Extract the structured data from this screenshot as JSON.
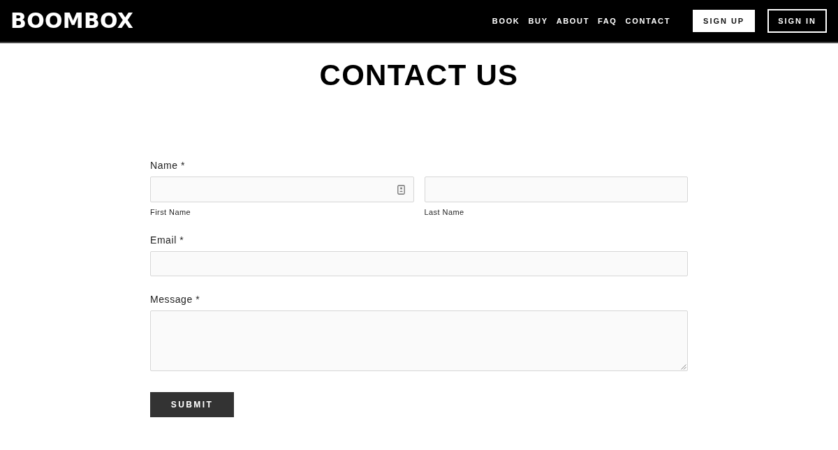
{
  "header": {
    "logo": "BOOMBOX",
    "nav": [
      {
        "label": "BOOK"
      },
      {
        "label": "BUY"
      },
      {
        "label": "ABOUT"
      },
      {
        "label": "FAQ"
      },
      {
        "label": "CONTACT"
      }
    ],
    "buttons": [
      {
        "label": "SIGN UP",
        "kind": "filled"
      },
      {
        "label": "SIGN IN",
        "kind": "outline"
      }
    ]
  },
  "title": "CONTACT US",
  "form": {
    "fields": [
      {
        "kind": "split",
        "label": "Name *",
        "inputs": [
          {
            "sublabel": "First Name",
            "autofill_icon": true
          },
          {
            "sublabel": "Last Name",
            "autofill_icon": false
          }
        ]
      },
      {
        "kind": "line",
        "label": "Email *"
      },
      {
        "kind": "area",
        "label": "Message *"
      }
    ],
    "submit": "SUBMIT"
  }
}
